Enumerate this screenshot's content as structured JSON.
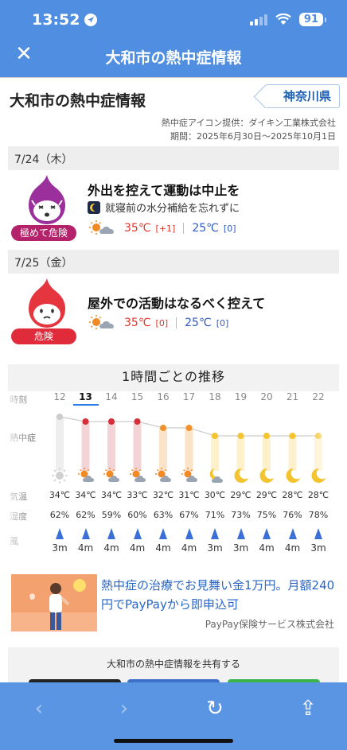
{
  "status": {
    "time": "13:52",
    "battery": "91"
  },
  "nav": {
    "title": "大和市の熱中症情報",
    "close_label": "✕"
  },
  "header": {
    "title": "大和市の熱中症情報",
    "prefecture": "神奈川県"
  },
  "credit": {
    "line1": "熱中症アイコン提供：ダイキン工業株式会社",
    "line2": "期間：2025年6月30日〜2025年10月1日"
  },
  "days": [
    {
      "date": "7/24（木）",
      "level": "極めて危険",
      "level_color": "#b3226b",
      "mascot_color": "#9b2f9b",
      "advice": "外出を控えて運動は中止を",
      "note": "就寝前の水分補給を忘れずに",
      "high": "35℃",
      "high_diff": "[+1]",
      "low": "25℃",
      "low_diff": "[0]"
    },
    {
      "date": "7/25（金）",
      "level": "危険",
      "level_color": "#e02b3b",
      "mascot_color": "#e5353f",
      "advice": "屋外での活動はなるべく控えて",
      "high": "35℃",
      "high_diff": "[0]",
      "low": "25℃",
      "low_diff": "[0]"
    }
  ],
  "hourly": {
    "title": "1時間ごとの推移",
    "labels": {
      "hour": "時刻",
      "heat": "熱中症",
      "temp": "気温",
      "humidity": "湿度",
      "wind": "風"
    },
    "hours": [
      "12",
      "13",
      "14",
      "15",
      "16",
      "17",
      "18",
      "19",
      "20",
      "21",
      "22"
    ],
    "current_hour": "13",
    "heat_levels": [
      "severe",
      "danger",
      "danger",
      "danger",
      "warning",
      "warning",
      "caution",
      "caution",
      "caution",
      "caution",
      "caution"
    ],
    "weather": [
      "sun",
      "sun-cloud",
      "sun-cloud",
      "sun-cloud",
      "sun-cloud",
      "sun-cloud",
      "moon-cloud",
      "moon",
      "moon",
      "moon",
      "moon"
    ],
    "temps": [
      "34℃",
      "34℃",
      "34℃",
      "33℃",
      "32℃",
      "31℃",
      "30℃",
      "29℃",
      "29℃",
      "28℃",
      "28℃"
    ],
    "humidity": [
      "62%",
      "62%",
      "59%",
      "60%",
      "63%",
      "67%",
      "71%",
      "73%",
      "75%",
      "76%",
      "78%"
    ],
    "wind": [
      "3m",
      "4m",
      "4m",
      "4m",
      "4m",
      "4m",
      "3m",
      "3m",
      "4m",
      "4m",
      "3m"
    ],
    "colors": {
      "severe": "#cccccc",
      "danger": "#d62d38",
      "warning": "#f0922c",
      "caution": "#f4c430"
    }
  },
  "ad": {
    "text": "熱中症の治療でお見舞い金1万円。月額240円でPayPayから即申込可",
    "sponsor": "PayPay保険サービス株式会社"
  },
  "share": {
    "title": "大和市の熱中症情報を共有する"
  },
  "toolbar": {
    "back": "‹",
    "forward": "›",
    "reload": "↻",
    "share": "⇪"
  }
}
